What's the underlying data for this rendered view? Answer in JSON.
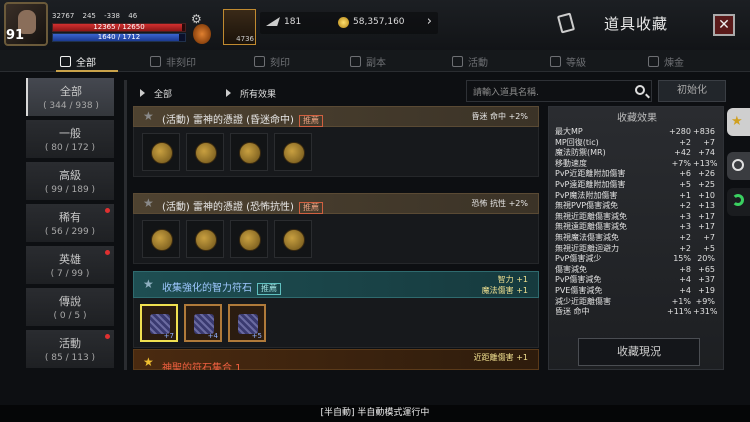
{
  "player": {
    "level": "91",
    "stat1": "32767",
    "stat2": "245",
    "stat3": "-338",
    "stat4": "46",
    "hp": "12365 / 12650",
    "hp_pct": 0.977,
    "mp": "1640 / 1712",
    "mp_pct": 0.958
  },
  "potion_count": "4736",
  "currency": {
    "feather": "181",
    "gold": "58,357,160"
  },
  "header": {
    "title": "道具收藏",
    "close": "✕"
  },
  "tabs": [
    {
      "label": "全部",
      "active": true
    },
    {
      "label": "非刻印",
      "active": false
    },
    {
      "label": "刻印",
      "active": false
    },
    {
      "label": "副本",
      "active": false
    },
    {
      "label": "活動",
      "active": false
    },
    {
      "label": "等級",
      "active": false
    },
    {
      "label": "煉金",
      "active": false
    }
  ],
  "sidebar": [
    {
      "name": "全部",
      "count": "( 344 / 938 )"
    },
    {
      "name": "一般",
      "count": "( 80 / 172 )"
    },
    {
      "name": "高級",
      "count": "( 99 / 189 )"
    },
    {
      "name": "稀有",
      "count": "( 56 / 299 )"
    },
    {
      "name": "英雄",
      "count": "( 7 / 99 )"
    },
    {
      "name": "傳說",
      "count": "( 0 / 5 )"
    },
    {
      "name": "活動",
      "count": "( 85 / 113 )"
    }
  ],
  "filters": {
    "category": "全部",
    "effect": "所有效果"
  },
  "search": {
    "placeholder": "請輸入道具名稱."
  },
  "reset_label": "初始化",
  "entries": [
    {
      "name": "(活動) 雷神的憑證 (昏迷命中)",
      "badge": "推薦",
      "effect": "昏迷 命中 +2%"
    },
    {
      "name": "(活動) 雷神的憑證 (恐怖抗性)",
      "badge": "推薦",
      "effect": "恐怖 抗性 +2%"
    },
    {
      "name": "收集強化的智力符石",
      "badge": "推薦",
      "effect1": "智力 +1",
      "effect2": "魔法傷害 +1",
      "subs": [
        "+7",
        "+4",
        "+5"
      ]
    }
  ],
  "partial_entry": {
    "name": "神聖的符石集合 1",
    "effect": "近距離傷害 +1"
  },
  "panel": {
    "title": "收藏效果",
    "rows": [
      {
        "name": "最大MP",
        "a": "+280",
        "b": "+836"
      },
      {
        "name": "MP回復(tic)",
        "a": "+2",
        "b": "+7"
      },
      {
        "name": "魔法防禦(MR)",
        "a": "+42",
        "b": "+74"
      },
      {
        "name": "移動速度",
        "a": "+7%",
        "b": "+13%"
      },
      {
        "name": "PvP近距離附加傷害",
        "a": "+6",
        "b": "+26"
      },
      {
        "name": "PvP遠距離附加傷害",
        "a": "+5",
        "b": "+25"
      },
      {
        "name": "PvP魔法附加傷害",
        "a": "+1",
        "b": "+10"
      },
      {
        "name": "無視PVP傷害減免",
        "a": "+2",
        "b": "+13"
      },
      {
        "name": "無視近距離傷害減免",
        "a": "+3",
        "b": "+17"
      },
      {
        "name": "無視遠距離傷害減免",
        "a": "+3",
        "b": "+17"
      },
      {
        "name": "無視魔法傷害減免",
        "a": "+2",
        "b": "+7"
      },
      {
        "name": "無視近距離迴避力",
        "a": "+2",
        "b": "+5"
      },
      {
        "name": "PvP傷害減少",
        "a": "15%",
        "b": "20%"
      },
      {
        "name": "傷害減免",
        "a": "+8",
        "b": "+65"
      },
      {
        "name": "PvP傷害減免",
        "a": "+4",
        "b": "+37"
      },
      {
        "name": "PVE傷害減免",
        "a": "+4",
        "b": "+19"
      },
      {
        "name": "減少近距離傷害",
        "a": "+1%",
        "b": "+9%"
      },
      {
        "name": "昏迷 命中",
        "a": "+11%",
        "b": "+31%"
      }
    ],
    "button": "收藏現況"
  },
  "status_bar": "[半自動] 半自動模式運行中"
}
